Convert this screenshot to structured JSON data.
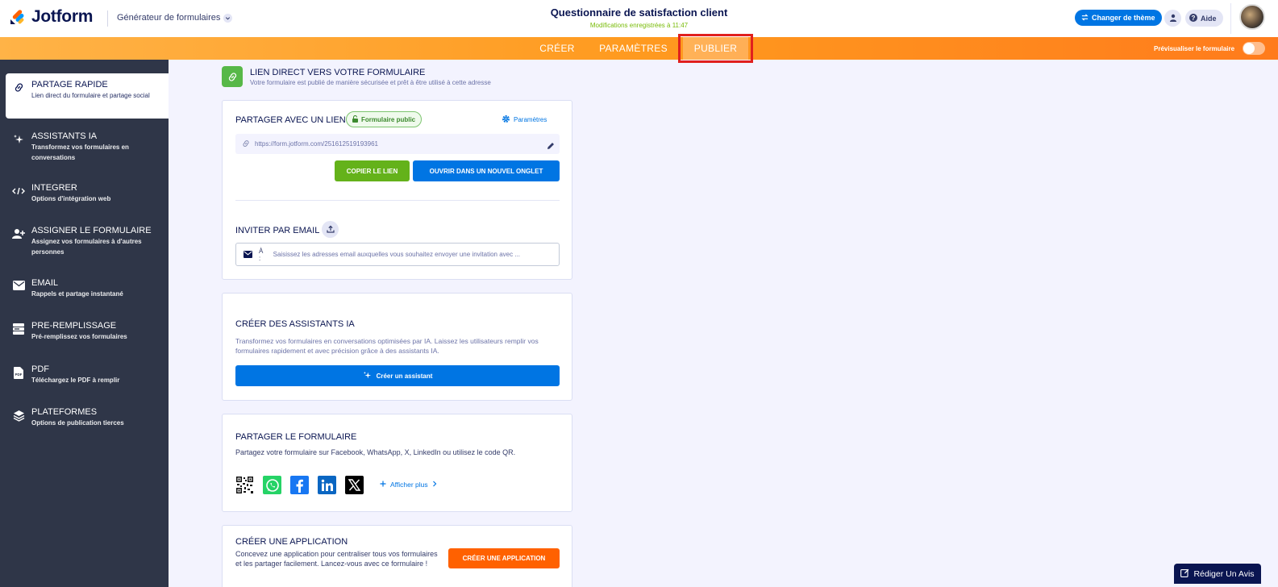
{
  "header": {
    "logo_text": "Jotform",
    "builder_label": "Générateur de formulaires",
    "form_title": "Questionnaire de satisfaction client",
    "saved_status": "Modifications enregistrées à 11:47",
    "theme_button": "Changer de thème",
    "help_button": "Aide"
  },
  "nav": {
    "tabs": [
      {
        "label": "CRÉER"
      },
      {
        "label": "PARAMÈTRES"
      },
      {
        "label": "PUBLIER",
        "active": true
      }
    ],
    "preview_label": "Prévisualiser le formulaire",
    "preview_toggle_on": false
  },
  "sidebar": {
    "items": [
      {
        "title": "PARTAGE RAPIDE",
        "subtitle": "Lien direct du formulaire et partage social",
        "icon": "link-icon",
        "active": true
      },
      {
        "title": "ASSISTANTS IA",
        "subtitle": "Transformez vos formulaires en conversations",
        "icon": "sparkle-icon"
      },
      {
        "title": "INTEGRER",
        "subtitle": "Options d'intégration web",
        "icon": "code-icon"
      },
      {
        "title": "ASSIGNER LE FORMULAIRE",
        "subtitle": "Assignez vos formulaires à d'autres personnes",
        "icon": "assign-user-icon"
      },
      {
        "title": "EMAIL",
        "subtitle": "Rappels et partage instantané",
        "icon": "envelope-icon"
      },
      {
        "title": "PRE-REMPLISSAGE",
        "subtitle": "Pré-remplissez vos formulaires",
        "icon": "prefill-icon"
      },
      {
        "title": "PDF",
        "subtitle": "Téléchargez le PDF à remplir",
        "icon": "pdf-icon"
      },
      {
        "title": "PLATEFORMES",
        "subtitle": "Options de publication tierces",
        "icon": "layers-icon"
      }
    ]
  },
  "direct_link": {
    "title": "LIEN DIRECT VERS VOTRE FORMULAIRE",
    "subtitle": "Votre formulaire est publié de manière sécurisée et prêt à être utilisé à cette adresse"
  },
  "share_card": {
    "title": "PARTAGER AVEC UN LIEN",
    "public_badge": "Formulaire public",
    "settings_link": "Paramètres",
    "url": "https://form.jotform.com/251612519193961",
    "copy_button": "COPIER LE LIEN",
    "open_button": "OUVRIR DANS UN NOUVEL ONGLET",
    "invite_title": "INVITER PAR EMAIL",
    "email_prefix": "À :",
    "email_placeholder": "Saisissez les adresses email auxquelles vous souhaitez envoyer une invitation avec ..."
  },
  "ai_card": {
    "title": "CRÉER DES ASSISTANTS IA",
    "description": "Transformez vos formulaires en conversations optimisées par IA. Laissez les utilisateurs remplir vos formulaires rapidement et avec précision grâce à des assistants IA.",
    "button": "Créer un assistant"
  },
  "social_card": {
    "title": "PARTAGER LE FORMULAIRE",
    "description": "Partagez votre formulaire sur Facebook, WhatsApp, X, LinkedIn ou utilisez le code QR.",
    "more_link": "Afficher plus"
  },
  "app_card": {
    "title": "CRÉER UNE APPLICATION",
    "description": "Concevez une application pour centraliser tous vos formulaires et les partager facilement. Lancez-vous avec ce formulaire !",
    "button": "CRÉER UNE APPLICATION"
  },
  "review_button": "Rédiger Un Avis",
  "colors": {
    "navy": "#0a1551",
    "blue": "#0075e3",
    "green_button": "#64b21a",
    "orange_button": "#ff6100",
    "sidebar_bg": "#2f3648",
    "highlight": "#e0201e"
  }
}
